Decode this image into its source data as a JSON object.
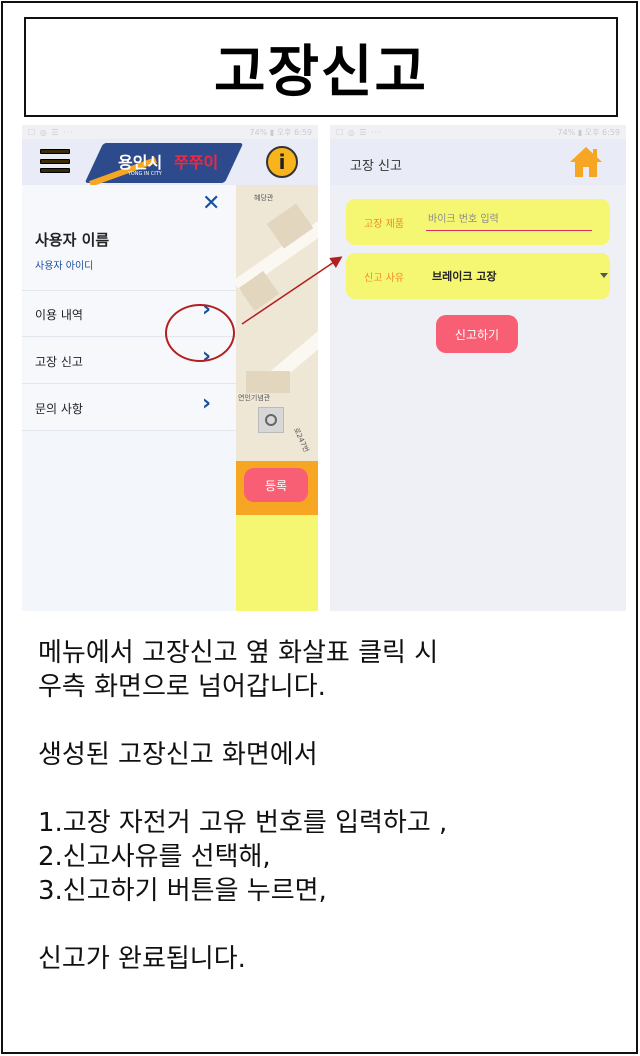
{
  "title": "고장신고",
  "left_screen": {
    "status_bar": {
      "left": "☐ ◎ ☰ ···",
      "right": "74% ▮ 오후 6:59"
    },
    "logo": {
      "main": "용인시",
      "accent": "쭈쭈이",
      "sub": "YONG IN CITY"
    },
    "info_button": "i",
    "drawer": {
      "close": "✕",
      "user_name": "사용자 이름",
      "user_id": "사용자 아이디",
      "items": [
        {
          "label": "이용 내역",
          "chevron": "›"
        },
        {
          "label": "고장 신고",
          "chevron": "›"
        },
        {
          "label": "문의 사항",
          "chevron": "›"
        }
      ]
    },
    "map_labels": [
      "혜당관",
      "연인기념관",
      "로247번"
    ],
    "register_button": "등록"
  },
  "right_screen": {
    "status_bar": {
      "left": "☐ ◎ ☰ ···",
      "right": "74% ▮ 오후 6:59"
    },
    "title": "고장 신고",
    "product_field": {
      "label": "고장 제품",
      "placeholder": "바이크 번호 입력"
    },
    "reason_field": {
      "label": "신고 사유",
      "value": "브레이크 고장"
    },
    "report_button": "신고하기"
  },
  "description": [
    "메뉴에서 고장신고 옆 화살표 클릭 시",
    "우측 화면으로 넘어갑니다.",
    "",
    "생성된 고장신고 화면에서",
    "",
    "1.고장 자전거 고유 번호를 입력하고 ,",
    "2.신고사유를 선택해,",
    "3.신고하기 버튼을 누르면,",
    "",
    "신고가 완료됩니다."
  ],
  "colors": {
    "accent_yellow": "#f5f773",
    "button_pink": "#f85e74",
    "brand_blue": "#1b4f9c",
    "home_orange": "#f7a623",
    "annotation_red": "#b31f1f"
  }
}
